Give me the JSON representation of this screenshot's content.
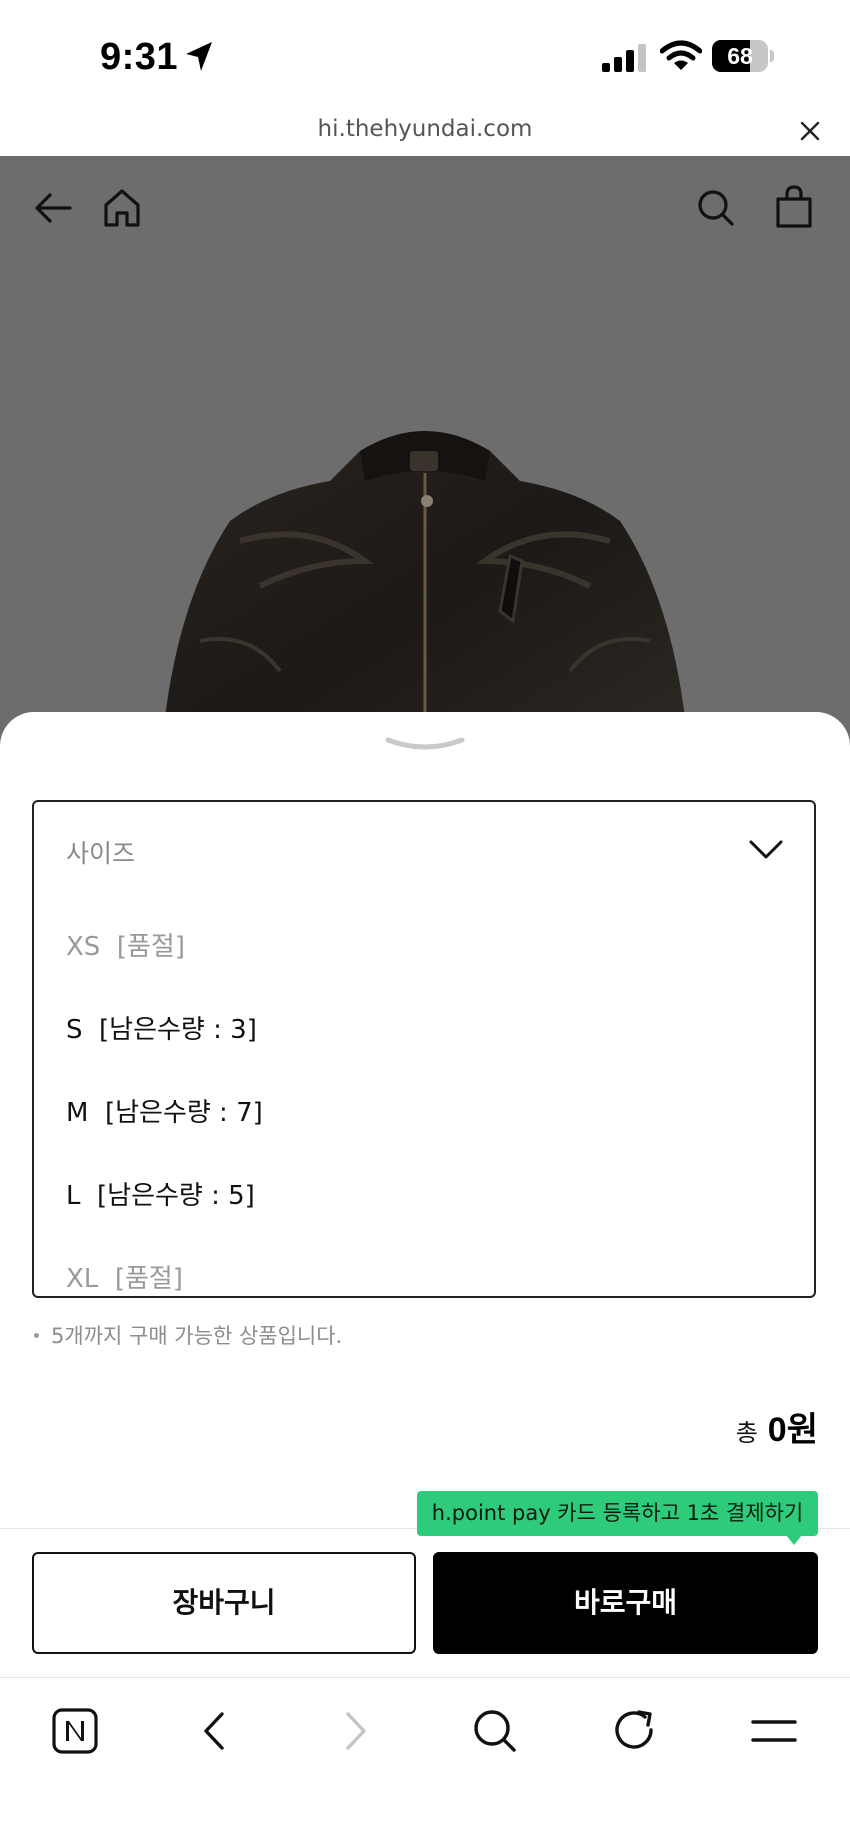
{
  "status_bar": {
    "time": "9:31",
    "battery_level": "68",
    "battery_fraction": 0.68,
    "icons": [
      "location-arrow-icon",
      "cellular-signal-icon",
      "wifi-icon",
      "battery-icon"
    ]
  },
  "browser": {
    "url": "hi.thehyundai.com",
    "close_icon": "close-icon"
  },
  "product_nav": {
    "icons": [
      "back-arrow-icon",
      "home-icon",
      "search-icon",
      "shopping-bag-icon"
    ],
    "image": "leather-jacket-image"
  },
  "size_selector": {
    "label": "사이즈",
    "options": [
      {
        "text": "XS  [품절]",
        "available": false
      },
      {
        "text": "S  [남은수량 : 3]",
        "available": true
      },
      {
        "text": "M  [남은수량 : 7]",
        "available": true
      },
      {
        "text": "L  [남은수량 : 5]",
        "available": true
      },
      {
        "text": "XL  [품절]",
        "available": false
      }
    ]
  },
  "purchase_limit_note": "5개까지 구매 가능한 상품입니다.",
  "total": {
    "label": "총",
    "value": "0원"
  },
  "promo_tooltip": "h.point pay 카드 등록하고 1초 결제하기",
  "actions": {
    "cart_label": "장바구니",
    "buy_now_label": "바로구매"
  },
  "browser_toolbar": {
    "icons": [
      "naver-home-icon",
      "back-icon",
      "forward-icon",
      "search-icon",
      "refresh-icon",
      "menu-icon"
    ]
  },
  "colors": {
    "overlay": "#6d6d6d",
    "promo_green": "#2ecb7a",
    "buy_button": "#000000",
    "sold_out_text": "#9a9a9a"
  }
}
